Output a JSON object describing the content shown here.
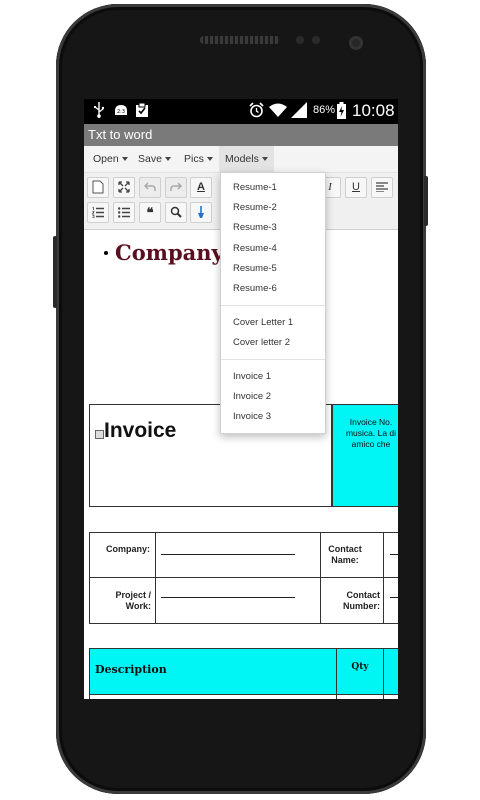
{
  "status_bar": {
    "battery": "86%",
    "time": "10:08",
    "icons": [
      "usb-icon",
      "voicemail-icon",
      "clipboard-icon",
      "alarm-icon",
      "wifi-icon",
      "signal-icon",
      "battery-icon"
    ]
  },
  "app_title": "Txt to word",
  "menu": {
    "open": "Open",
    "save": "Save",
    "pics": "Pics",
    "models": "Models"
  },
  "toolbar": {
    "bold_a": "A",
    "italic": "I",
    "underline": "U",
    "quote": "❝"
  },
  "models_dropdown": {
    "group1": [
      "Resume-1",
      "Resume-2",
      "Resume-3",
      "Resume-4",
      "Resume-5",
      "Resume-6"
    ],
    "group2": [
      "Cover Letter 1",
      "Cover letter 2"
    ],
    "group3": [
      "Invoice 1",
      "Invoice 2",
      "Invoice 3"
    ]
  },
  "document": {
    "company_heading": "Company",
    "invoice_title": "Invoice",
    "invoice_info_line1": "Invoice No.",
    "invoice_info_line2": "musica. La di",
    "invoice_info_line3": "amico che",
    "company_label": "Company:",
    "project_label_1": "Project /",
    "project_label_2": "Work:",
    "contact_name_label_1": "Contact",
    "contact_name_label_2": "Name:",
    "contact_number_label_1": "Contact",
    "contact_number_label_2": "Number:",
    "col_description": "Description",
    "col_qty": "Qty"
  },
  "colors": {
    "title_bar": "#7a7a7a",
    "cyan_cells": "#00f5f5",
    "heading": "#5a0f1e"
  }
}
